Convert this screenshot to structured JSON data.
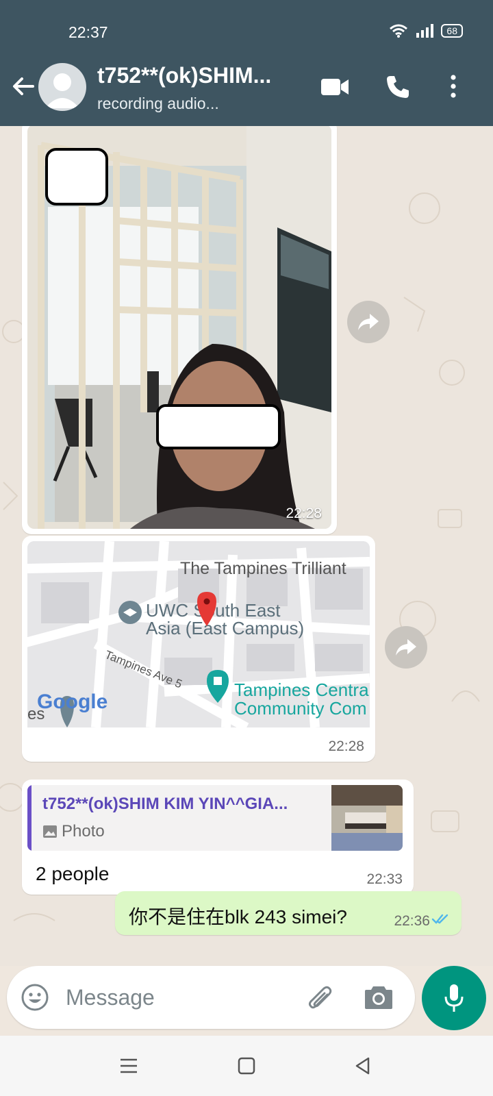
{
  "status_bar": {
    "time": "22:37",
    "battery": "68"
  },
  "header": {
    "contact_name": "t752**(ok)SHIM...",
    "contact_status": "recording audio...",
    "icons": [
      "back-arrow-icon",
      "video-call-icon",
      "phone-icon",
      "more-vert-icon"
    ]
  },
  "messages": [
    {
      "type": "image",
      "time": "22:28"
    },
    {
      "type": "location",
      "time": "22:28",
      "map_labels": {
        "place1": "The Tampines Trilliant",
        "place2_line1": "UWC South East",
        "place2_line2": "Asia (East Campus)",
        "road": "Tampines Ave 5",
        "place3_line1": "Tampines Centra",
        "place3_line2": "Community Com",
        "edge_label": "es",
        "logo": "Google"
      }
    },
    {
      "type": "reply",
      "quoted_name": "t752**(ok)SHIM KIM YIN^^GIA...",
      "quoted_type": "Photo",
      "text": "2 people",
      "time": "22:33"
    },
    {
      "type": "outgoing",
      "text": "你不是住在blk 243 simei?",
      "time": "22:36",
      "read": true
    }
  ],
  "composer": {
    "placeholder": "Message"
  },
  "colors": {
    "header": "#3e5561",
    "accent": "#00957f",
    "outgoing": "#dcf8c6",
    "reply_bar": "#6a4fc7"
  }
}
